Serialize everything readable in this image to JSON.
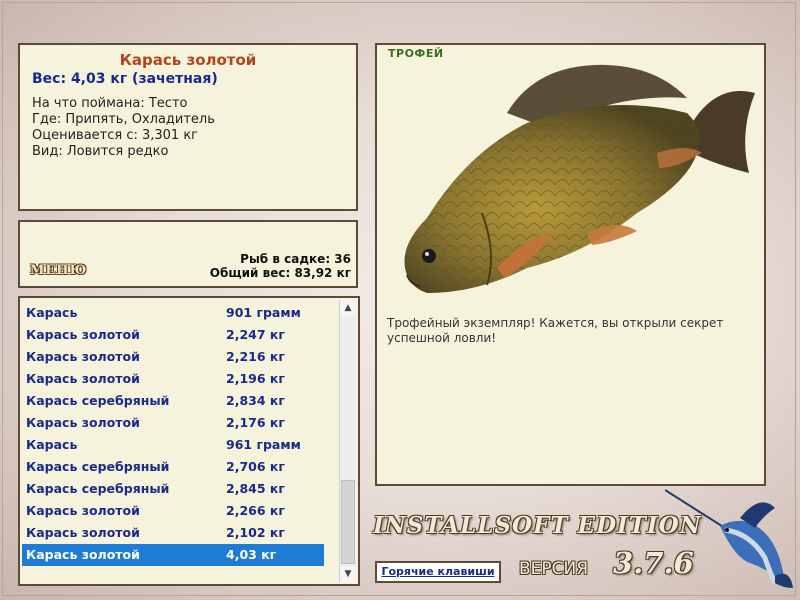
{
  "fish_info": {
    "name": "Карась золотой",
    "weight": "Вес: 4,03 кг (зачетная)",
    "details": [
      "На что поймана: Тесто",
      "Где: Припять, Охладитель",
      "Оценивается с: 3,301 кг",
      "Вид: Ловится редко"
    ]
  },
  "menu_button": "МЕНЮ",
  "stats": {
    "count": "Рыб в садке: 36",
    "total": "Общий вес: 83,92 кг"
  },
  "catch_list": [
    {
      "name": "Карась",
      "weight": "901 грамм"
    },
    {
      "name": "Карась золотой",
      "weight": "2,247 кг"
    },
    {
      "name": "Карась золотой",
      "weight": "2,216 кг"
    },
    {
      "name": "Карась золотой",
      "weight": "2,196 кг"
    },
    {
      "name": "Карась серебряный",
      "weight": "2,834 кг"
    },
    {
      "name": "Карась золотой",
      "weight": "2,176 кг"
    },
    {
      "name": "Карась",
      "weight": "961 грамм"
    },
    {
      "name": "Карась серебряный",
      "weight": "2,706 кг"
    },
    {
      "name": "Карась серебряный",
      "weight": "2,845 кг"
    },
    {
      "name": "Карась золотой",
      "weight": "2,266 кг"
    },
    {
      "name": "Карась золотой",
      "weight": "2,102 кг"
    },
    {
      "name": "Карась золотой",
      "weight": "4,03 кг"
    }
  ],
  "selected_index": 11,
  "trophy": {
    "label": "ТРОФЕЙ",
    "text": "Трофейный экземпляр! Кажется, вы открыли секрет успешной ловли!"
  },
  "branding": {
    "edition": "INSTALLSOFT EDITION",
    "version_label": "ВЕРСИЯ",
    "version_number": "3.7.6"
  },
  "hotkeys_button": "Горячие клавиши",
  "colors": {
    "panel_bg": "#f6f3dc",
    "panel_border": "#5c4a3a",
    "fish_name": "#b4451a",
    "list_text": "#1a2a8c",
    "selection": "#1e7bd6",
    "trophy_label": "#3a6e1e"
  },
  "icons": {
    "scroll_up": "chevron-up-icon",
    "scroll_down": "chevron-down-icon",
    "decoration": "marlin-icon"
  }
}
